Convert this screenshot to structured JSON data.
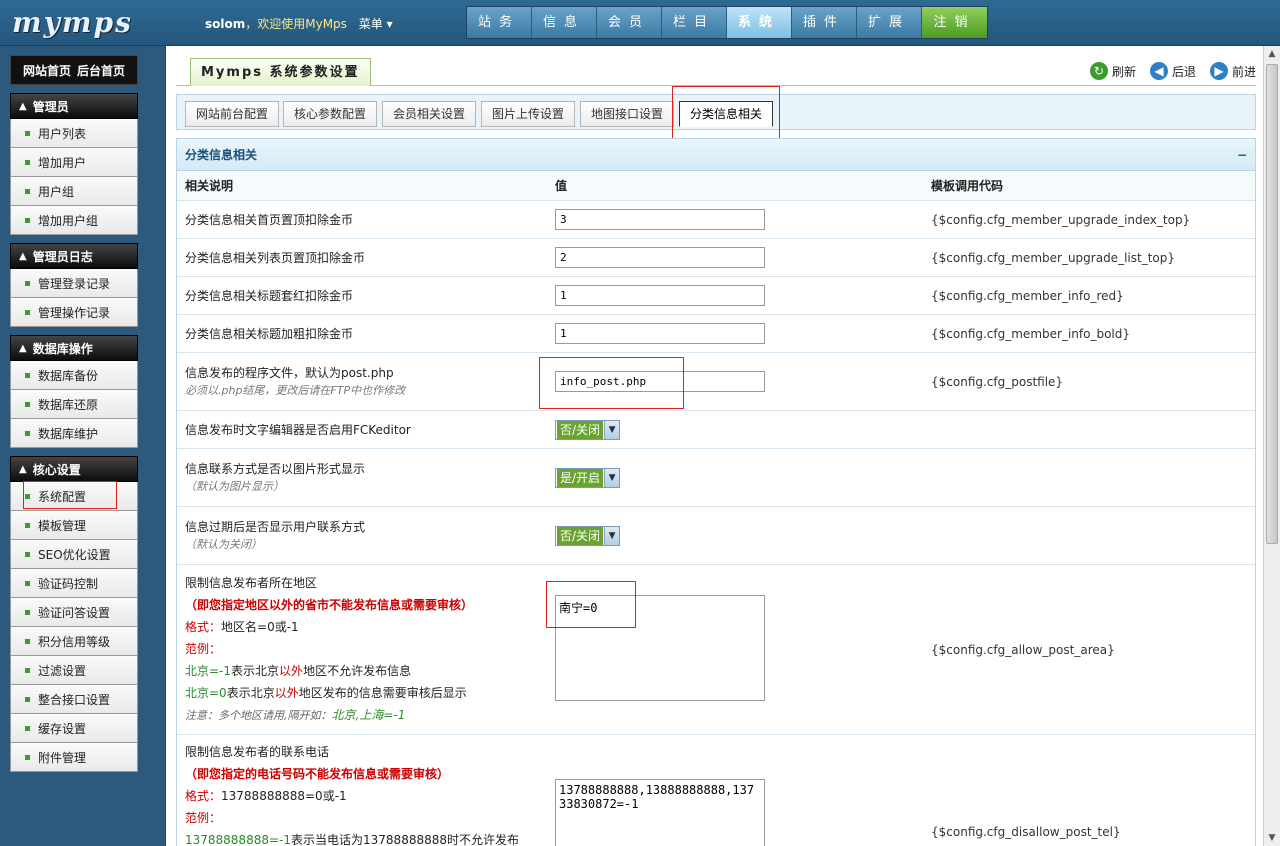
{
  "topbar": {
    "logo": "mymps",
    "user": "solom",
    "welcome": "，欢迎使用MyMps",
    "menu": "菜单 ▾",
    "nav": [
      "站务",
      "信息",
      "会员",
      "栏目",
      "系统",
      "插件",
      "扩展",
      "注销"
    ]
  },
  "sidebar": {
    "home": "网站首页",
    "admin_home": "后台首页",
    "groups": [
      {
        "title": "管理员",
        "items": [
          "用户列表",
          "增加用户",
          "用户组",
          "增加用户组"
        ]
      },
      {
        "title": "管理员日志",
        "items": [
          "管理登录记录",
          "管理操作记录"
        ]
      },
      {
        "title": "数据库操作",
        "items": [
          "数据库备份",
          "数据库还原",
          "数据库维护"
        ]
      },
      {
        "title": "核心设置",
        "items": [
          "系统配置",
          "模板管理",
          "SEO优化设置",
          "验证码控制",
          "验证问答设置",
          "积分信用等级",
          "过滤设置",
          "整合接口设置",
          "缓存设置",
          "附件管理"
        ]
      }
    ]
  },
  "header": {
    "title": "Mymps 系统参数设置",
    "refresh": "刷新",
    "back": "后退",
    "forward": "前进"
  },
  "tabs": [
    "网站前台配置",
    "核心参数配置",
    "会员相关设置",
    "图片上传设置",
    "地图接口设置",
    "分类信息相关"
  ],
  "panel": {
    "title": "分类信息相关",
    "collapse": "−",
    "col_desc": "相关说明",
    "col_value": "值",
    "col_code": "模板调用代码",
    "rows": {
      "r1": {
        "label": "分类信息相关首页置顶扣除金币",
        "value": "3",
        "code": "{$config.cfg_member_upgrade_index_top}"
      },
      "r2": {
        "label": "分类信息相关列表页置顶扣除金币",
        "value": "2",
        "code": "{$config.cfg_member_upgrade_list_top}"
      },
      "r3": {
        "label": "分类信息相关标题套红扣除金币",
        "value": "1",
        "code": "{$config.cfg_member_info_red}"
      },
      "r4": {
        "label": "分类信息相关标题加粗扣除金币",
        "value": "1",
        "code": "{$config.cfg_member_info_bold}"
      },
      "r5": {
        "label": "信息发布的程序文件，默认为post.php",
        "sub": "必须以.php结尾，更改后请在FTP中也作修改",
        "value": "info_post.php",
        "code": "{$config.cfg_postfile}"
      },
      "r6": {
        "label": "信息发布时文字编辑器是否启用FCKeditor",
        "value": "否/关闭"
      },
      "r7": {
        "label": "信息联系方式是否以图片形式显示",
        "sub": "（默认为图片显示）",
        "value": "是/开启"
      },
      "r8": {
        "label": "信息过期后是否显示用户联系方式",
        "sub": "（默认为关闭）",
        "value": "否/关闭"
      },
      "r9": {
        "label": "限制信息发布者所在地区",
        "warn": "（即您指定地区以外的省市不能发布信息或需要审核）",
        "fmt_label": "格式：",
        "fmt": "地区名=0或-1",
        "ex_label": "范例：",
        "ex1_a": "北京=-1",
        "ex1_b": "表示北京",
        "ex1_c": "以外",
        "ex1_d": "地区不允许发布信息",
        "ex2_a": "北京=0",
        "ex2_b": "表示北京",
        "ex2_c": "以外",
        "ex2_d": "地区发布的信息需要审核后显示",
        "note_a": "注意：多个地区请用,隔开如：",
        "note_b": "北京,上海=-1",
        "value": "南宁=0",
        "code": "{$config.cfg_allow_post_area}"
      },
      "r10": {
        "label": "限制信息发布者的联系电话",
        "warn": "（即您指定的电话号码不能发布信息或需要审核）",
        "fmt_label": "格式：",
        "fmt": "13788888888=0或-1",
        "ex_label": "范例：",
        "ex1_a": "13788888888=-1",
        "ex1_b": "表示当电话为13788888888时不允许发布",
        "value": "13788888888,13888888888,13733830872=-1",
        "code": "{$config.cfg_disallow_post_tel}"
      }
    }
  }
}
